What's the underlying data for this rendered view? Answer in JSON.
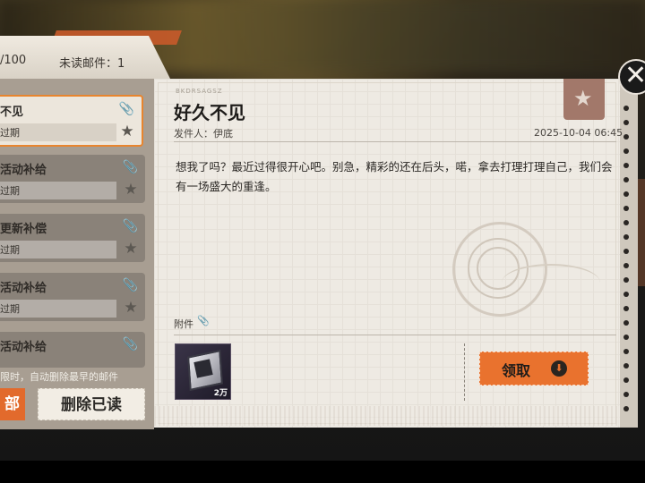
{
  "header": {
    "mail_count": "/100",
    "unread_label": "未读邮件：1"
  },
  "mail_list": {
    "items": [
      {
        "title": "不见",
        "status": "过期",
        "active": true
      },
      {
        "title": "活动补给",
        "status": "过期",
        "active": false
      },
      {
        "title": "更新补偿",
        "status": "过期",
        "active": false
      },
      {
        "title": "活动补给",
        "status": "过期",
        "active": false
      },
      {
        "title": "活动补给",
        "status": "",
        "active": false
      }
    ],
    "notice": "限时，自动删除最早的邮件",
    "delete_all_label": "部",
    "delete_read_label": "删除已读"
  },
  "letter": {
    "code": "BKDRSAGSZ",
    "title": "好久不见",
    "sender": "发件人：伊底",
    "date": "2025-10-04 06:45",
    "body": "想我了吗？最近过得很开心吧。别急，精彩的还在后头，喏，拿去打理打理自己，我们会有一场盛大的重逢。",
    "attachment_label": "附件",
    "attachment": {
      "icon": "material-item-icon",
      "quantity": "2万"
    },
    "claim_label": "领取"
  },
  "icons": {
    "close": "close-icon",
    "favorite": "star-icon",
    "clip": "paperclip-icon",
    "claim": "download-arrow-icon"
  },
  "colors": {
    "accent": "#e9722e",
    "letter_bg": "#eeeae3"
  }
}
